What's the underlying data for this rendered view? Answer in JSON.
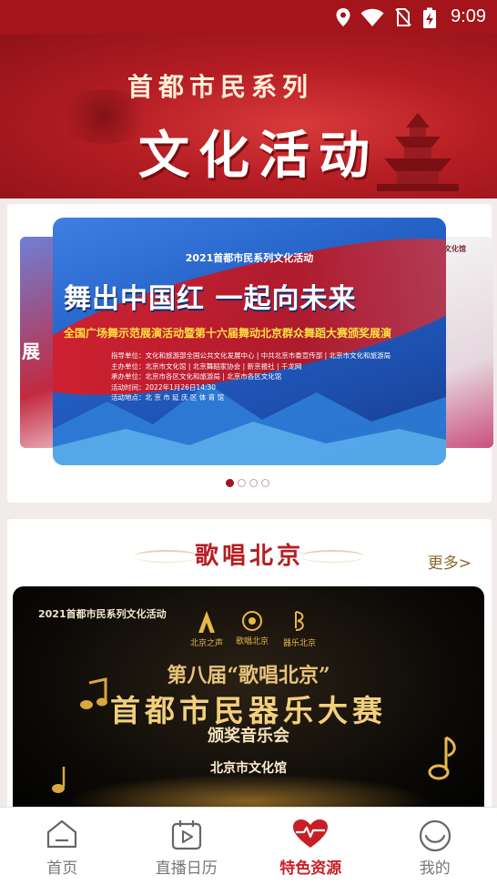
{
  "status_bar": {
    "time": "9:09"
  },
  "header": {
    "subtitle": "首都市民系列",
    "title": "文化活动"
  },
  "carousel": {
    "left_slide_text": "展",
    "right_slide_text": "文化馆",
    "main_slide": {
      "top_text": "2021首都市民系列文化活动",
      "headline": "舞出中国红 一起向未来",
      "subline": "全国广场舞示范展演活动暨第十六届舞动北京群众舞蹈大赛颁奖展演",
      "info": [
        "指导单位：文化和旅游部全国公共文化发展中心 | 中共北京市委宣传部 | 北京市文化和旅游局",
        "主办单位：北京市文化馆 | 北京舞蹈家协会 | 新京报社 | 千龙网",
        "承办单位：北京市各区文化和旅游局 | 北京市各区文化馆",
        "活动时间：2022年1月26日14:30",
        "活动地点：北 京 市 延 庆 区 体 育 馆"
      ]
    },
    "page_count": 4,
    "active_index": 0
  },
  "section": {
    "title": "歌唱北京",
    "more_label": "更多>",
    "poster": {
      "top_text": "2021首都市民系列文化活动",
      "logos": [
        "北京之声",
        "歌唱北京",
        "器乐北京"
      ],
      "line1": "第八届“歌唱北京”",
      "line2": "首都市民器乐大赛",
      "line3": "颁奖音乐会",
      "line4": "北京市文化馆"
    }
  },
  "tabbar": {
    "items": [
      {
        "label": "首页",
        "icon": "home-icon"
      },
      {
        "label": "直播日历",
        "icon": "calendar-play-icon"
      },
      {
        "label": "特色资源",
        "icon": "heart-pulse-icon"
      },
      {
        "label": "我的",
        "icon": "smile-face-icon"
      }
    ],
    "active_index": 2,
    "active_color": "#c81f27",
    "inactive_color": "#777777"
  },
  "colors": {
    "brand_red": "#a3141b",
    "gold": "#e8c47a"
  }
}
